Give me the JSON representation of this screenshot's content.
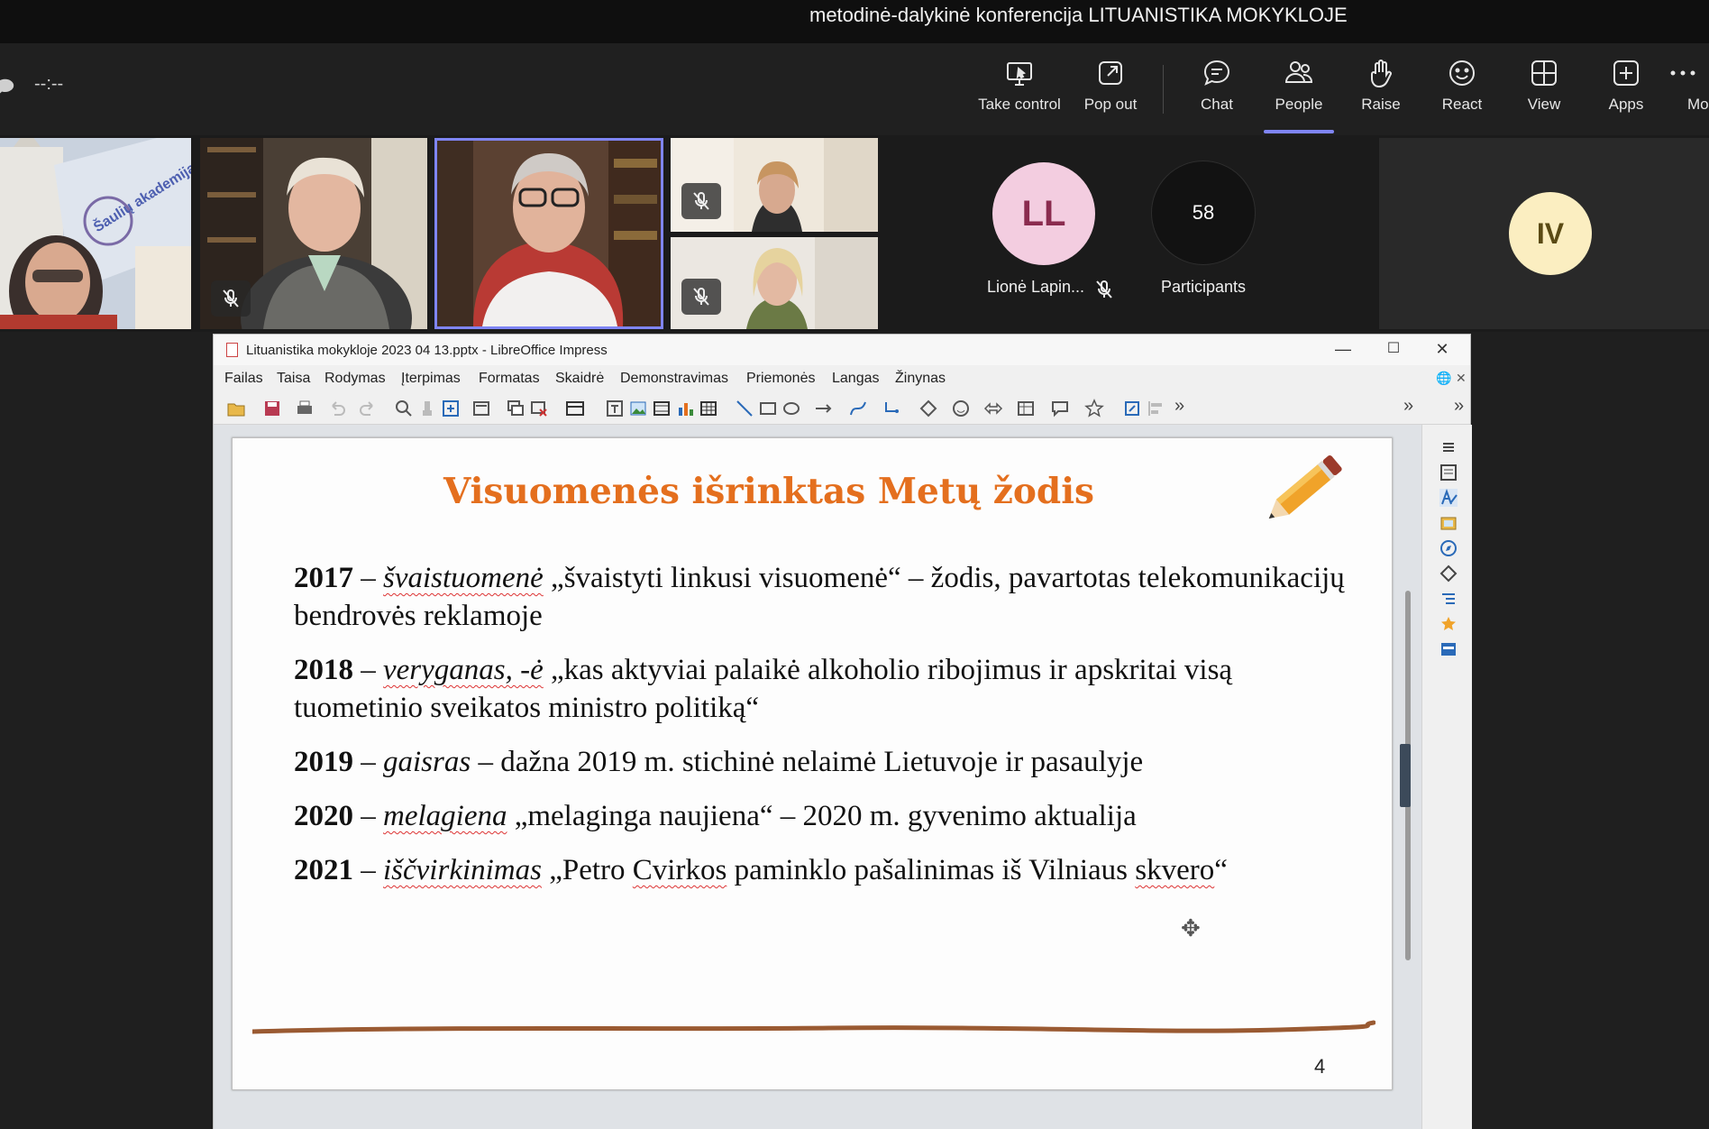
{
  "meeting": {
    "title": "metodinė-dalykinė konferencija LITUANISTIKA MOKYKLOJE",
    "timer": "--:--",
    "left_edge_glyph": "🗩"
  },
  "toolbar": {
    "buttons": [
      {
        "label": "Take control",
        "icon": "take-control-icon"
      },
      {
        "label": "Pop out",
        "icon": "pop-out-icon"
      },
      {
        "label": "Chat",
        "icon": "chat-icon"
      },
      {
        "label": "People",
        "icon": "people-icon",
        "active": true
      },
      {
        "label": "Raise",
        "icon": "raise-hand-icon"
      },
      {
        "label": "React",
        "icon": "react-icon"
      },
      {
        "label": "View",
        "icon": "view-icon"
      },
      {
        "label": "Apps",
        "icon": "apps-icon"
      },
      {
        "label": "Mo",
        "icon": "more-icon"
      }
    ]
  },
  "participants": {
    "avatar_ll": {
      "initials": "LL",
      "name": "Lionė Lapin...",
      "bg": "#f3cde0",
      "fg": "#8a2b4f"
    },
    "count": {
      "value": "58",
      "label": "Participants"
    },
    "avatar_iv": {
      "initials": "IV",
      "bg": "#fbeec1",
      "fg": "#5a4a14"
    },
    "banner_text": "Šaulių akademija",
    "accent": "#7f85f5"
  },
  "libreoffice": {
    "window_title": "Lituanistika mokykloje 2023 04 13.pptx - LibreOffice Impress",
    "window_controls": {
      "minimize": "—",
      "maximize": "☐",
      "close": "✕"
    },
    "menu": [
      "Failas",
      "Taisa",
      "Rodymas",
      "Įterpimas",
      "Formatas",
      "Skaidrė",
      "Demonstravimas",
      "Priemonės",
      "Langas",
      "Žinynas"
    ],
    "menu_right": {
      "globe": "🌐",
      "close": "✕"
    },
    "toolbar_overflow": "»"
  },
  "slide": {
    "title": "Visuomenės išrinktas Metų žodis",
    "title_color": "#e46f1e",
    "page_number": "4",
    "cursor": "✥",
    "entries": [
      {
        "year": "2017",
        "dash": " – ",
        "term": "švaistuomenė",
        "rest": " „švaistyti linkusi visuomenė“ – žodis, pavartotas telekomunikacijų bendrovės reklamoje"
      },
      {
        "year": "2018",
        "dash": " – ",
        "term": "veryganas, -ė",
        "rest": " „kas aktyviai palaikė alkoholio ribojimus ir apskritai visą tuometinio sveikatos ministro politiką“"
      },
      {
        "year": "2019",
        "dash": " – ",
        "term": "gaisras",
        "rest": " – dažna 2019 m. stichinė nelaimė Lietuvoje ir pasaulyje"
      },
      {
        "year": "2020",
        "dash": " – ",
        "term": "melagiena",
        "rest": " „melaginga naujiena“ – 2020 m. gyvenimo aktualija"
      },
      {
        "year": "2021",
        "dash": " – ",
        "term": "iščvirkinimas",
        "rest_a": "  „Petro ",
        "rest_b": "Cvirkos",
        "rest_c": " paminklo pašalinimas iš Vilniaus ",
        "rest_d": "skvero",
        "rest_e": "“"
      }
    ]
  }
}
